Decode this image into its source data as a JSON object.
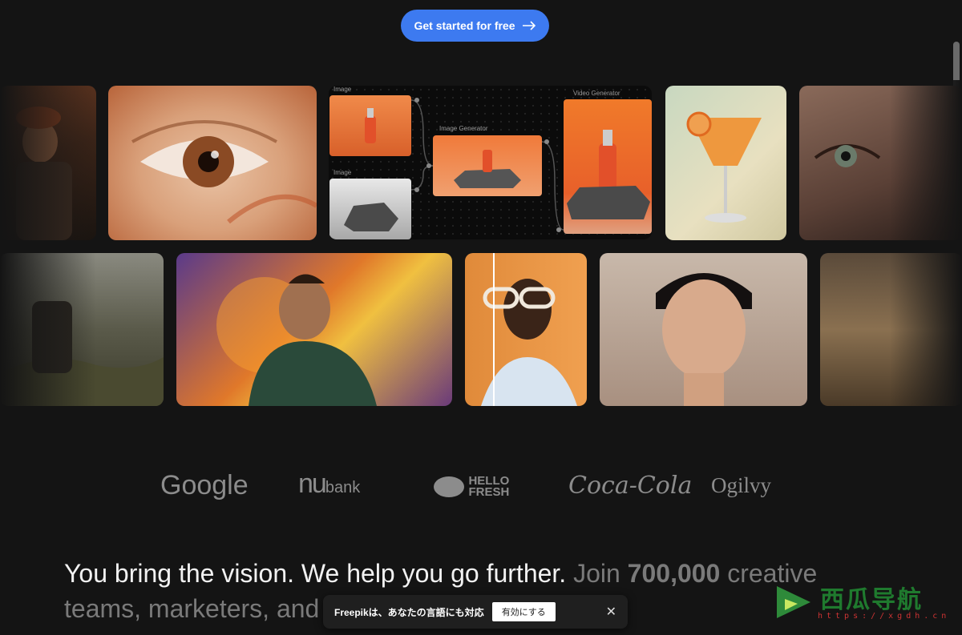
{
  "cta": {
    "label": "Get started for free"
  },
  "workflow": {
    "nodes": [
      {
        "label": "Image"
      },
      {
        "label": "Image"
      },
      {
        "label": "Image Generator"
      },
      {
        "label": "Video Generator"
      }
    ]
  },
  "logos": [
    {
      "name": "Google"
    },
    {
      "name": "nu",
      "suffix": "bank"
    },
    {
      "name": "HELLO",
      "line2": "FRESH"
    },
    {
      "name": "Coca-Cola"
    },
    {
      "name": "Ogilvy"
    }
  ],
  "headline": {
    "lead": "You bring the vision. We help you go further.",
    "join": "Join",
    "count": "700,000",
    "tail": "creative teams, marketers, and"
  },
  "toast": {
    "text": "Freepikは、あなたの言語にも対応",
    "button": "有効にする"
  },
  "watermark": {
    "title": "西瓜导航",
    "url": "https://xgdh.cn"
  },
  "colors": {
    "accent": "#3d7af0",
    "background": "#141414"
  }
}
